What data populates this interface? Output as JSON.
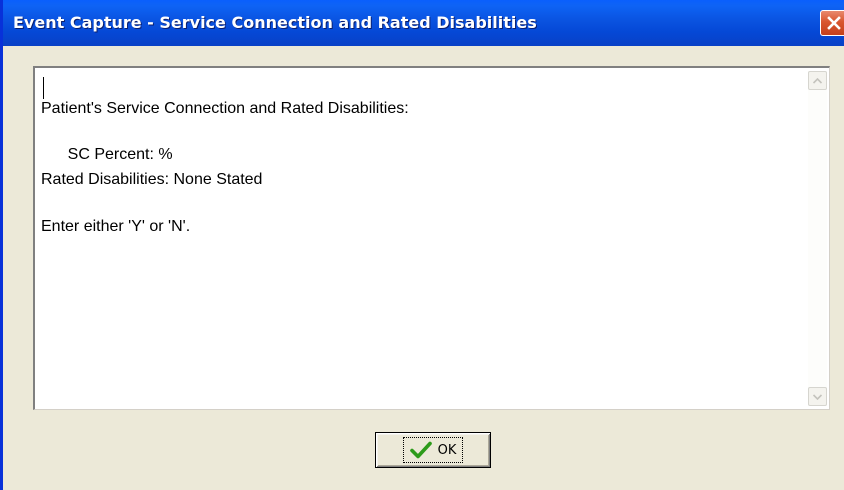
{
  "window": {
    "title": "Event Capture - Service Connection and Rated Disabilities"
  },
  "icons": {
    "close": "close-icon",
    "scroll_up": "scroll-up-arrow-icon",
    "scroll_down": "scroll-down-arrow-icon",
    "ok": "checkmark-icon"
  },
  "message": {
    "lines": [
      "Patient's Service Connection and Rated Disabilities:",
      "      SC Percent: %",
      "Rated Disabilities: None Stated",
      "Enter either 'Y' or 'N'."
    ]
  },
  "buttons": {
    "ok_label": "OK"
  },
  "colors": {
    "titlebar": "#0a53e0",
    "close_button": "#d9562f",
    "checkmark": "#2d9b1a"
  }
}
